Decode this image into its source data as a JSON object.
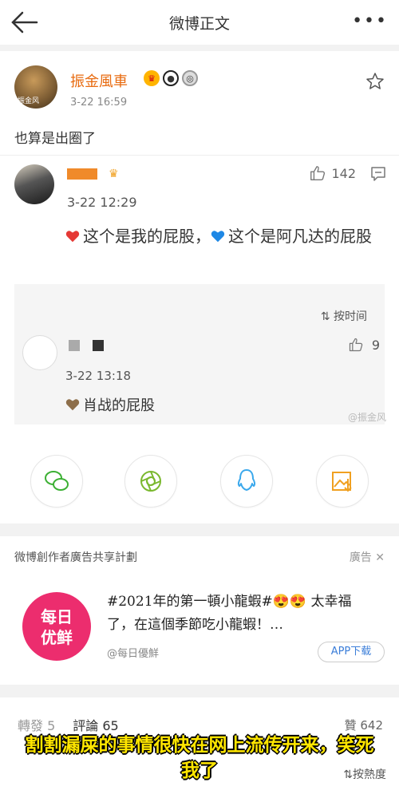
{
  "nav": {
    "title": "微博正文",
    "more": "•••"
  },
  "post": {
    "author": "振金風車",
    "avatar_tag": "振金风",
    "time": "3-22 16:59",
    "text": "也算是出圈了"
  },
  "comment": {
    "time": "3-22 12:29",
    "likes": "142",
    "text_part1": "这个是我的屁股，",
    "text_part2": "这个是阿凡达的屁股"
  },
  "sub_comments": {
    "sort_label": "按时间",
    "time": "3-22 13:18",
    "likes": "9",
    "text": "肖战的屁股"
  },
  "watermark": "@振金风",
  "share": {
    "icons": [
      "wechat-icon",
      "moments-icon",
      "qq-icon",
      "save-image-icon"
    ]
  },
  "ad": {
    "title": "微博創作者廣告共享計劃",
    "label": "廣告",
    "logo_line1": "每日",
    "logo_line2": "优鲜",
    "text": "#2021年的第一頓小龍蝦#😍😍 太幸福了，在這個季節吃小龍蝦！…",
    "source": "@每日優鮮",
    "button": "APP下载"
  },
  "bottom": {
    "repost": "轉發 5",
    "comments": "評論 65",
    "likes": "贊 642",
    "sort": "按熱度"
  },
  "subtitle": "割割漏屎的事情很快在网上流传开来，笑死我了",
  "colors": {
    "accent": "#e86b10",
    "subtitle": "#ffe600",
    "ad_logo": "#ec2d6e"
  }
}
